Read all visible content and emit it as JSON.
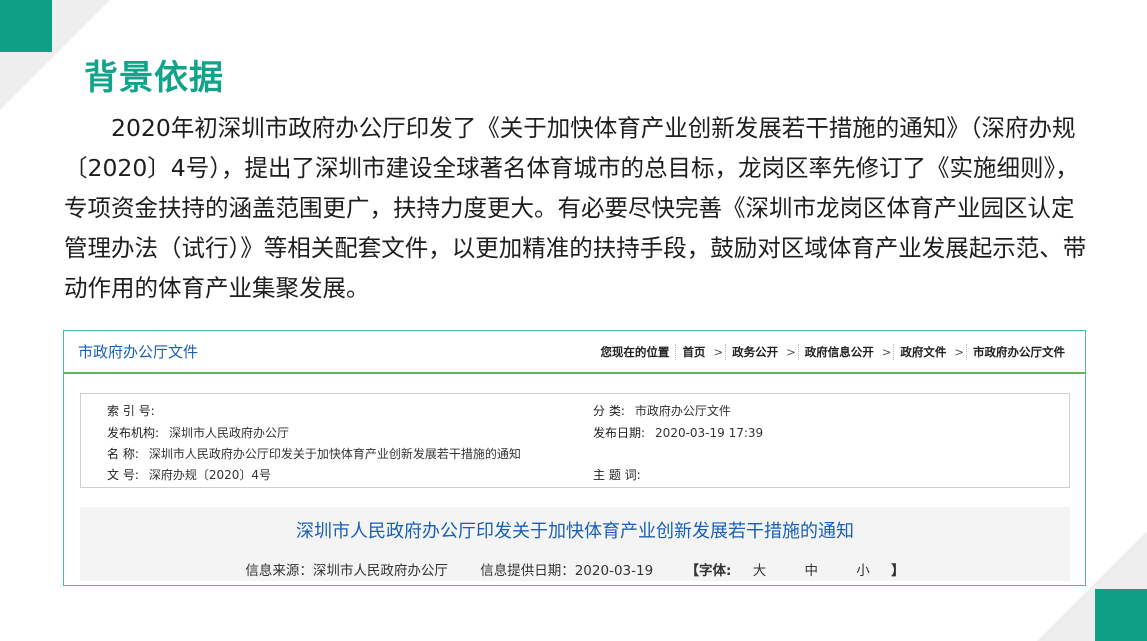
{
  "slide": {
    "title": "背景依据",
    "paragraph": "2020年初深圳市政府办公厅印发了《关于加快体育产业创新发展若干措施的通知》（深府办规〔2020〕4号），提出了深圳市建设全球著名体育城市的总目标，龙岗区率先修订了《实施细则》，专项资金扶持的涵盖范围更广，扶持力度更大。有必要尽快完善《深圳市龙岗区体育产业园区认定管理办法（试行）》等相关配套文件，以更加精准的扶持手段，鼓励对区域体育产业发展起示范、带动作用的体育产业集聚发展。"
  },
  "document": {
    "header_title": "市政府办公厅文件",
    "breadcrumb": {
      "location_label": "您现在的位置",
      "items": [
        "首页",
        "政务公开",
        "政府信息公开",
        "政府文件",
        "市政府办公厅文件"
      ],
      "separator": ">"
    },
    "meta": {
      "index_label": "索 引 号:",
      "index_value": "",
      "category_label": "分 类:",
      "category_value": "市政府办公厅文件",
      "publisher_label": "发布机构:",
      "publisher_value": "深圳市人民政府办公厅",
      "date_label": "发布日期:",
      "date_value": "2020-03-19 17:39",
      "name_label": "名 称:",
      "name_value": "深圳市人民政府办公厅印发关于加快体育产业创新发展若干措施的通知",
      "docno_label": "文 号:",
      "docno_value": "深府办规〔2020〕4号",
      "subject_label": "主 题 词:",
      "subject_value": ""
    },
    "title": "深圳市人民政府办公厅印发关于加快体育产业创新发展若干措施的通知",
    "source": "信息来源：深圳市人民政府办公厅",
    "provide_date": "信息提供日期：2020-03-19",
    "font_label": "【字体:",
    "font_large": "大",
    "font_medium": "中",
    "font_small": "小",
    "font_close": "】"
  },
  "colors": {
    "accent_green": "#0f9f86",
    "title_green": "#12a48a",
    "link_blue": "#1a5fb4"
  }
}
